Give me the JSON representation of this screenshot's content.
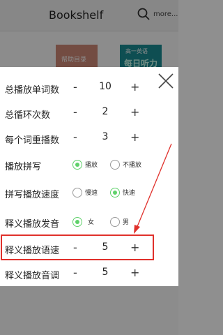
{
  "app": {
    "title": "Bookshelf",
    "more_label": "more...",
    "books": [
      {
        "title": "帮助目录"
      },
      {
        "tag": "高一英语",
        "title": "每日听力"
      }
    ]
  },
  "settings": {
    "rows": [
      {
        "label": "总播放单词数",
        "type": "stepper",
        "value": "10",
        "minus": "-",
        "plus": "+"
      },
      {
        "label": "总循环次数",
        "type": "stepper",
        "value": "2",
        "minus": "-",
        "plus": "+"
      },
      {
        "label": "每个词重播数",
        "type": "stepper",
        "value": "3",
        "minus": "-",
        "plus": "+"
      },
      {
        "label": "播放拼写",
        "type": "radio",
        "options": [
          "播放",
          "不播放"
        ],
        "selected": "播放"
      },
      {
        "label": "拼写播放速度",
        "type": "radio",
        "options": [
          "慢速",
          "快速"
        ],
        "selected": "快速"
      },
      {
        "label": "释义播放发音",
        "type": "radio",
        "options": [
          "女",
          "男"
        ],
        "selected": "女"
      },
      {
        "label": "释义播放语速",
        "type": "stepper",
        "value": "5",
        "minus": "-",
        "plus": "+"
      },
      {
        "label": "释义播放音调",
        "type": "stepper",
        "value": "5",
        "minus": "-",
        "plus": "+"
      }
    ]
  },
  "colors": {
    "accent": "#5fd16a",
    "annotation": "#e0302b"
  },
  "icons": {
    "close": "close-icon",
    "search": "search-icon"
  }
}
